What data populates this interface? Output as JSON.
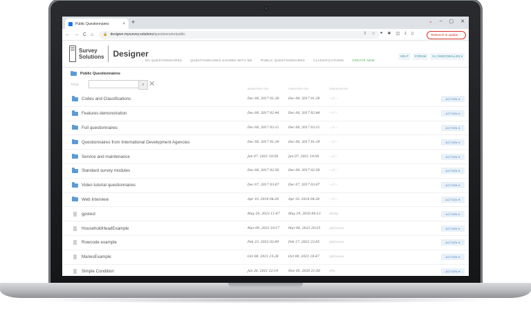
{
  "browser": {
    "tab_title": "Public Questionnaires",
    "tab_close": "×",
    "new_tab": "+",
    "url_host": "designer.mysurvey.solutions",
    "url_path": "/questionnaire/public",
    "relaunch": "Relaunch to update ⋮",
    "nav_back": "←",
    "nav_forward": "→",
    "reload": "C",
    "home": "⌂",
    "win_chevron": "⌄",
    "win_min": "–",
    "win_max": "▢",
    "win_close": "✕"
  },
  "app": {
    "logo_line1": "Survey",
    "logo_line2": "Solutions",
    "product": "Designer",
    "nav": [
      "MY QUESTIONNAIRES",
      "QUESTIONNAIRES SHARED WITH ME",
      "PUBLIC QUESTIONNAIRES",
      "CLASSIFICATIONS",
      "CREATE NEW"
    ],
    "help": "HELP",
    "forum": "FORUM",
    "user": "HI, OKBCOBALLES ▾"
  },
  "page": {
    "breadcrumb": "Public Questionnaires",
    "filter_label": "TITLE",
    "filter_value": "",
    "search_glyph": "⌕",
    "clear_glyph": "✕"
  },
  "table": {
    "headers": {
      "modified": "MODIFIED ON",
      "created": "CREATED ON",
      "by": "CREATED BY"
    },
    "action_label": "ACTION ▾",
    "rows": [
      {
        "kind": "folder",
        "name": "Codes and Classifications",
        "modified": "Dec 08, 2017 01:38",
        "created": "Dec 08, 2017 01:38",
        "by": "—//—"
      },
      {
        "kind": "folder",
        "name": "Features demonstration",
        "modified": "Dec 08, 2017 02:44",
        "created": "Dec 08, 2017 02:44",
        "by": "—//—"
      },
      {
        "kind": "folder",
        "name": "Full questionnaires",
        "modified": "Dec 08, 2017 03:11",
        "created": "Dec 08, 2017 03:11",
        "by": "—//—"
      },
      {
        "kind": "folder",
        "name": "Questionnaires from International Development Agencies",
        "modified": "Dec 08, 2017 01:39",
        "created": "Dec 08, 2017 01:39",
        "by": "—//—"
      },
      {
        "kind": "folder",
        "name": "Service and maintenance",
        "modified": "Jan 07, 2021 19:58",
        "created": "Jan 07, 2021 19:58",
        "by": "—//—"
      },
      {
        "kind": "folder",
        "name": "Standard survey modules",
        "modified": "Dec 08, 2017 02:58",
        "created": "Dec 08, 2017 02:58",
        "by": "—//—"
      },
      {
        "kind": "folder",
        "name": "Video tutorial questionnaires",
        "modified": "Dec 07, 2017 03:07",
        "created": "Dec 07, 2017 03:07",
        "by": "—//—"
      },
      {
        "kind": "folder",
        "name": "Web Interview",
        "modified": "Apr 10, 2018 04:28",
        "created": "Apr 10, 2018 04:28",
        "by": "—//—"
      },
      {
        "kind": "file",
        "name": "gpstest",
        "modified": "May 24, 2023 11:47",
        "created": "May 19, 2020 00:13",
        "by": "ebdfg"
      },
      {
        "kind": "file",
        "name": "HouseholdHeadExample",
        "modified": "Mar 09, 2023 19:17",
        "created": "Mar 06, 2023 20:25",
        "by": "ykdoxues"
      },
      {
        "kind": "file",
        "name": "Rowcode example",
        "modified": "Feb 23, 2022 02:49",
        "created": "Feb 17, 2022 23:05",
        "by": "ykdoxues"
      },
      {
        "kind": "file",
        "name": "MariesExample",
        "modified": "Oct 08, 2021 15:28",
        "created": "Oct 08, 2021 18:47",
        "by": "ykdoxues"
      },
      {
        "kind": "file",
        "name": "Simple Condition",
        "modified": "Jan 26, 2021 22:14",
        "created": "Nov 05, 2020 21:56",
        "by": "afty"
      }
    ]
  }
}
